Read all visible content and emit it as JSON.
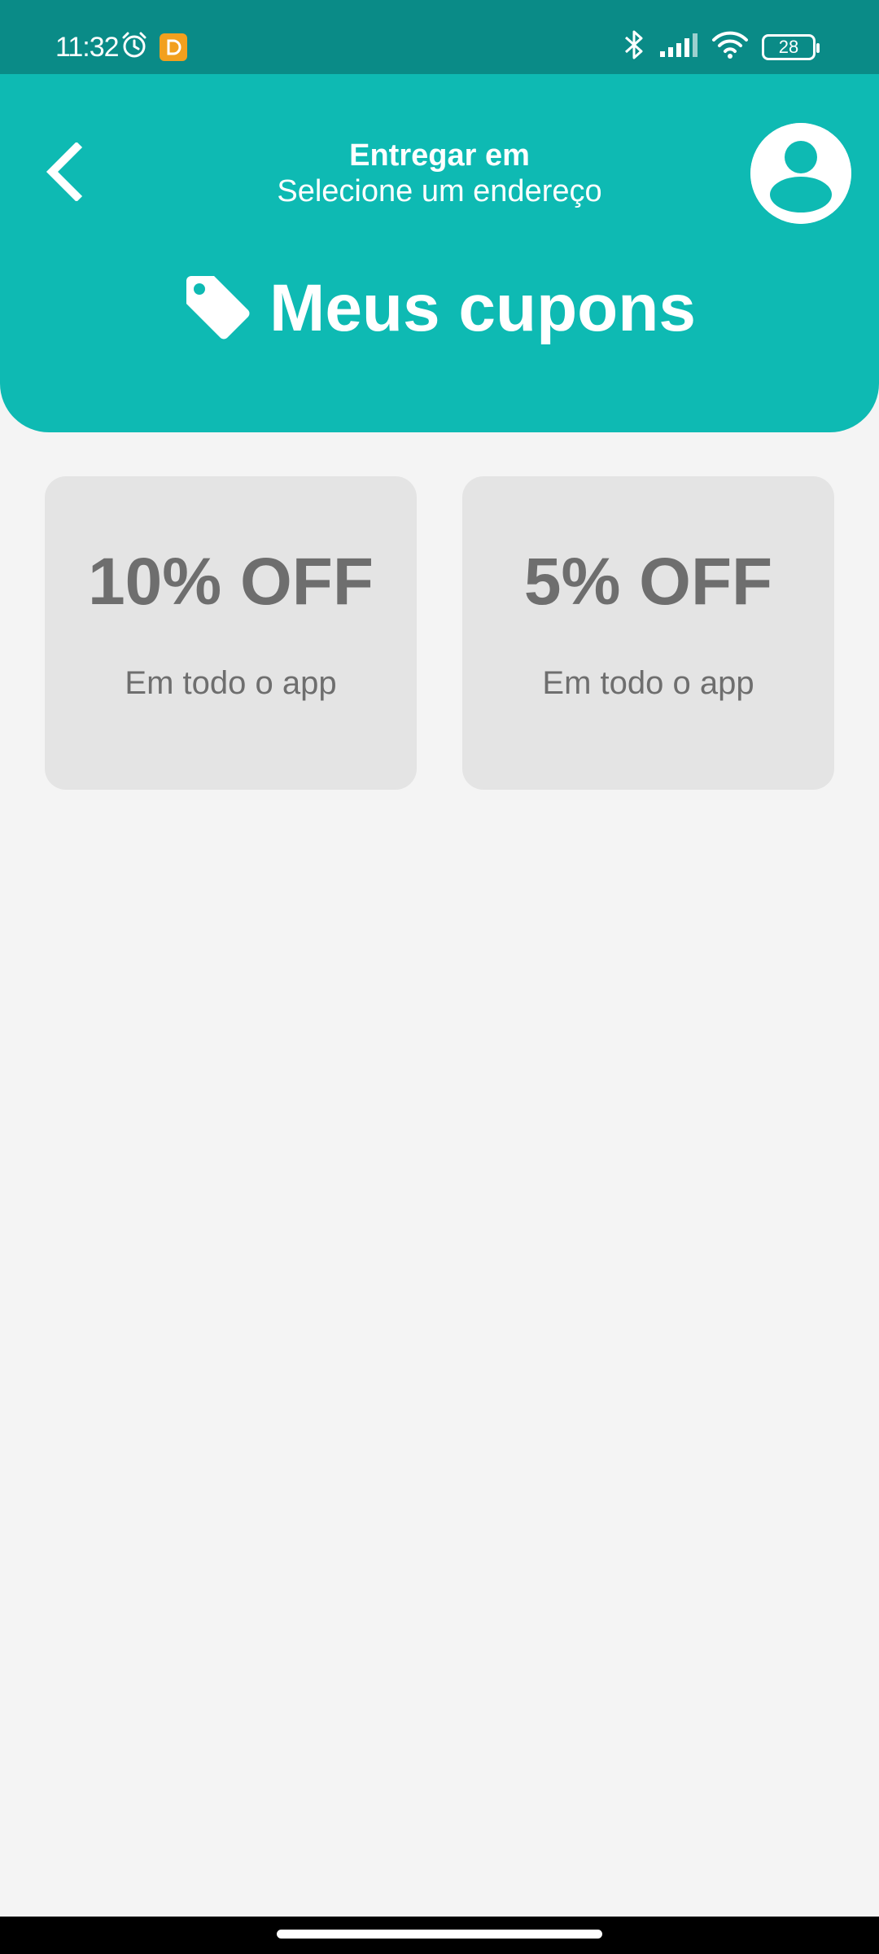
{
  "status_bar": {
    "time": "11:32",
    "battery": "28",
    "left_icons": [
      "alarm-icon",
      "app-notification-icon"
    ],
    "right_icons": [
      "bluetooth-icon",
      "signal-icon",
      "wifi-icon",
      "battery-icon"
    ]
  },
  "header": {
    "deliver_label": "Entregar em",
    "address_placeholder": "Selecione um endereço",
    "page_title": "Meus cupons",
    "title_icon": "tag-icon",
    "background_color": "#0ebab3"
  },
  "coupons": [
    {
      "value": "10% OFF",
      "description": "Em todo o app"
    },
    {
      "value": "5% OFF",
      "description": "Em todo o app"
    }
  ]
}
